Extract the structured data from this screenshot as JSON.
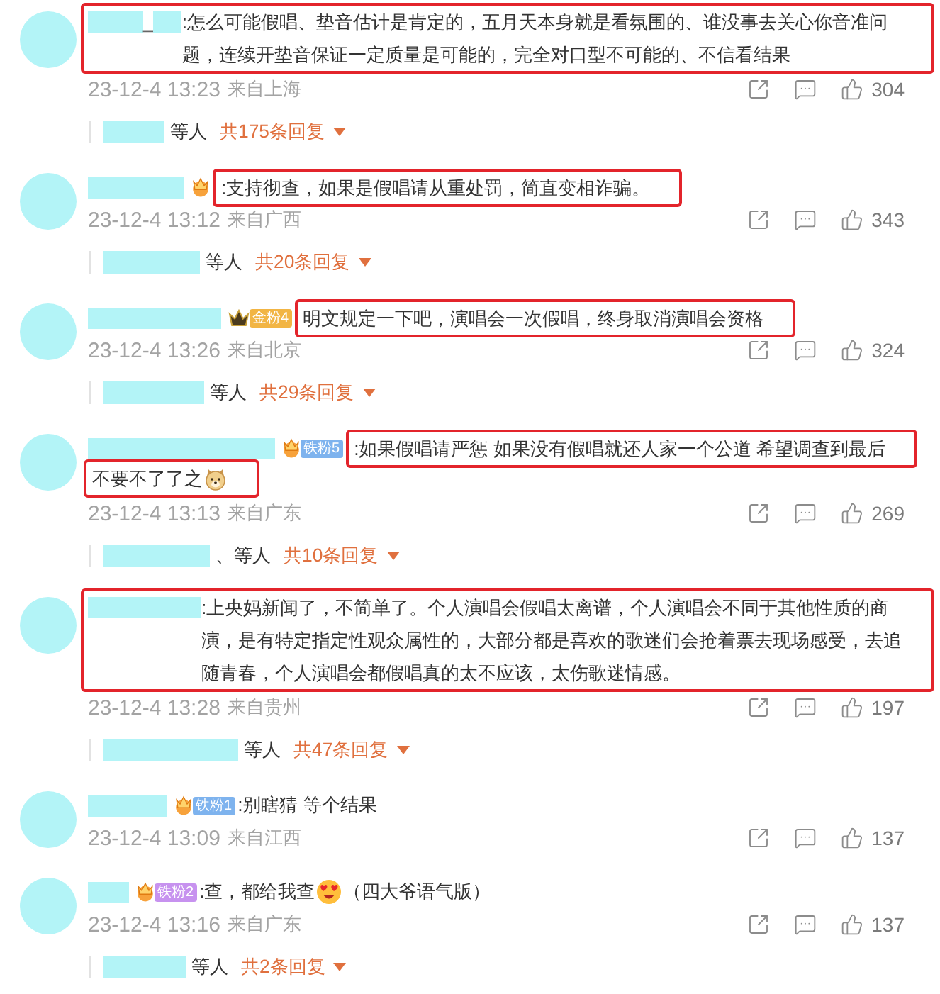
{
  "comments": [
    {
      "name": [
        {
          "kind": "mask"
        },
        {
          "kind": "text",
          "text": "_"
        },
        {
          "kind": "mask"
        }
      ],
      "name_highlighted": true,
      "segments": [
        {
          "highlighted": true,
          "parts": [
            {
              "kind": "text",
              "text": ":怎么可能假唱、垫音估计是肯定的，五月天本身就是看氛围的、谁没事去关心你音准问题，连续开垫音保证一定质量是可能的，完全对口型不可能的、不信看结果"
            }
          ]
        }
      ],
      "time": "23-12-4 13:23",
      "location": "来自上海",
      "likes": "304",
      "replies": {
        "people": "等人",
        "count": "共175条回复"
      }
    },
    {
      "name": [
        {
          "kind": "mask"
        }
      ],
      "name_highlighted": false,
      "badges": [
        {
          "kind": "medal"
        }
      ],
      "segments": [
        {
          "highlighted": true,
          "parts": [
            {
              "kind": "text",
              "text": ":支持彻查，如果是假唱请从重处罚，简直变相诈骗。"
            }
          ]
        }
      ],
      "time": "23-12-4 13:12",
      "location": "来自广西",
      "likes": "343",
      "replies": {
        "people": "等人",
        "count": "共20条回复"
      }
    },
    {
      "name": [
        {
          "kind": "mask"
        }
      ],
      "name_highlighted": false,
      "badges": [
        {
          "kind": "crown"
        },
        {
          "kind": "label",
          "text": "金粉4",
          "color": "#f2b544"
        }
      ],
      "segments": [
        {
          "highlighted": true,
          "parts": [
            {
              "kind": "text",
              "text": "明文规定一下吧，演唱会一次假唱，终身取消演唱会资格"
            }
          ]
        }
      ],
      "time": "23-12-4 13:26",
      "location": "来自北京",
      "likes": "324",
      "replies": {
        "people": "等人",
        "count": "共29条回复"
      }
    },
    {
      "name": [
        {
          "kind": "mask"
        }
      ],
      "name_highlighted": false,
      "badges": [
        {
          "kind": "medal"
        },
        {
          "kind": "label",
          "text": "铁粉5",
          "color": "#7eb3ee"
        }
      ],
      "segments": [
        {
          "highlighted": true,
          "parts": [
            {
              "kind": "text",
              "text": ":如果假唱请严惩 如果没有假唱就还人家一个公道 希望调查到最后"
            }
          ]
        },
        {
          "highlighted": true,
          "parts": [
            {
              "kind": "text",
              "text": "不要不了了之"
            },
            {
              "kind": "doge"
            }
          ]
        }
      ],
      "time": "23-12-4 13:13",
      "location": "来自广东",
      "likes": "269",
      "replies": {
        "people": "、等人",
        "count": "共10条回复"
      }
    },
    {
      "name": [
        {
          "kind": "mask"
        }
      ],
      "name_highlighted": true,
      "segments": [
        {
          "highlighted": true,
          "parts": [
            {
              "kind": "text",
              "text": ":上央妈新闻了，不简单了。个人演唱会假唱太离谱，个人演唱会不同于其他性质的商演，是有特定指定性观众属性的，大部分都是喜欢的歌迷们会抢着票去现场感受，去追随青春，个人演唱会都假唱真的太不应该，太伤歌迷情感。"
            }
          ]
        }
      ],
      "time": "23-12-4 13:28",
      "location": "来自贵州",
      "likes": "197",
      "replies": {
        "people": "等人",
        "count": "共47条回复"
      }
    },
    {
      "name": [
        {
          "kind": "mask"
        }
      ],
      "name_highlighted": false,
      "badges": [
        {
          "kind": "medal"
        },
        {
          "kind": "label",
          "text": "铁粉1",
          "color": "#7eb3ee"
        }
      ],
      "segments": [
        {
          "highlighted": false,
          "parts": [
            {
              "kind": "text",
              "text": ":别瞎猜 等个结果"
            }
          ]
        }
      ],
      "time": "23-12-4 13:09",
      "location": "来自江西",
      "likes": "137"
    },
    {
      "name": [
        {
          "kind": "mask"
        }
      ],
      "name_highlighted": false,
      "badges": [
        {
          "kind": "medal"
        },
        {
          "kind": "label",
          "text": "铁粉2",
          "color": "#c792ef"
        }
      ],
      "segments": [
        {
          "highlighted": false,
          "parts": [
            {
              "kind": "text",
              "text": ":查，都给我查"
            },
            {
              "kind": "hearteyes"
            },
            {
              "kind": "text",
              "text": "（四大爷语气版）"
            }
          ]
        }
      ],
      "time": "23-12-4 13:16",
      "location": "来自广东",
      "likes": "137",
      "replies": {
        "people": "等人",
        "count": "共2条回复"
      }
    }
  ]
}
